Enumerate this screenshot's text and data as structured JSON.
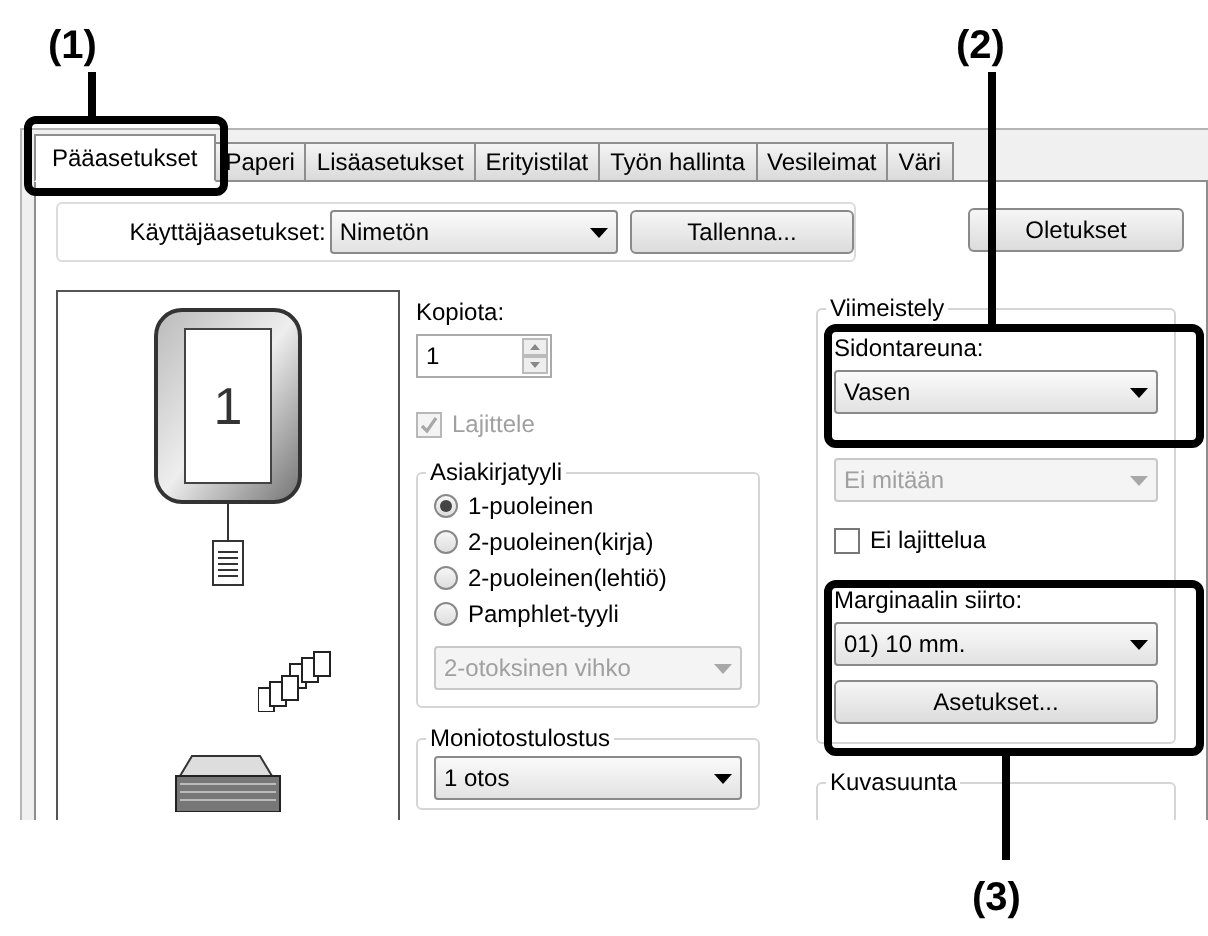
{
  "callouts": [
    {
      "label": "(1)"
    },
    {
      "label": "(2)"
    },
    {
      "label": "(3)"
    }
  ],
  "tabs": [
    {
      "label": "Pääasetukset",
      "selected": true
    },
    {
      "label": "Paperi",
      "selected": false
    },
    {
      "label": "Lisäasetukset",
      "selected": false
    },
    {
      "label": "Erityistilat",
      "selected": false
    },
    {
      "label": "Työn hallinta",
      "selected": false
    },
    {
      "label": "Vesileimat",
      "selected": false
    },
    {
      "label": "Väri",
      "selected": false
    }
  ],
  "user_settings": {
    "label": "Käyttäjäasetukset:",
    "value": "Nimetön",
    "save_button": "Tallenna...",
    "defaults_button": "Oletukset"
  },
  "preview": {
    "page_number": "1"
  },
  "copies": {
    "label": "Kopiota:",
    "value": "1"
  },
  "collate": {
    "label": "Lajittele",
    "checked": true,
    "disabled": true
  },
  "document_style": {
    "title": "Asiakirjatyyli",
    "options": [
      {
        "label": "1-puoleinen",
        "selected": true
      },
      {
        "label": "2-puoleinen(kirja)",
        "selected": false
      },
      {
        "label": "2-puoleinen(lehtiö)",
        "selected": false
      },
      {
        "label": "Pamphlet-tyyli",
        "selected": false
      }
    ],
    "booklet": {
      "value": "2-otoksinen vihko",
      "disabled": true
    }
  },
  "multi_output": {
    "title": "Moniotostulostus",
    "value": "1 otos"
  },
  "finishing": {
    "title": "Viimeistely",
    "binding_label": "Sidontareuna:",
    "binding_value": "Vasen",
    "staple": {
      "value": "Ei mitään",
      "disabled": true
    },
    "no_offset": {
      "label": "Ei lajittelua",
      "checked": false
    },
    "margin_label": "Marginaalin siirto:",
    "margin_value": "01) 10 mm.",
    "settings_button": "Asetukset..."
  },
  "orientation": {
    "title": "Kuvasuunta"
  }
}
